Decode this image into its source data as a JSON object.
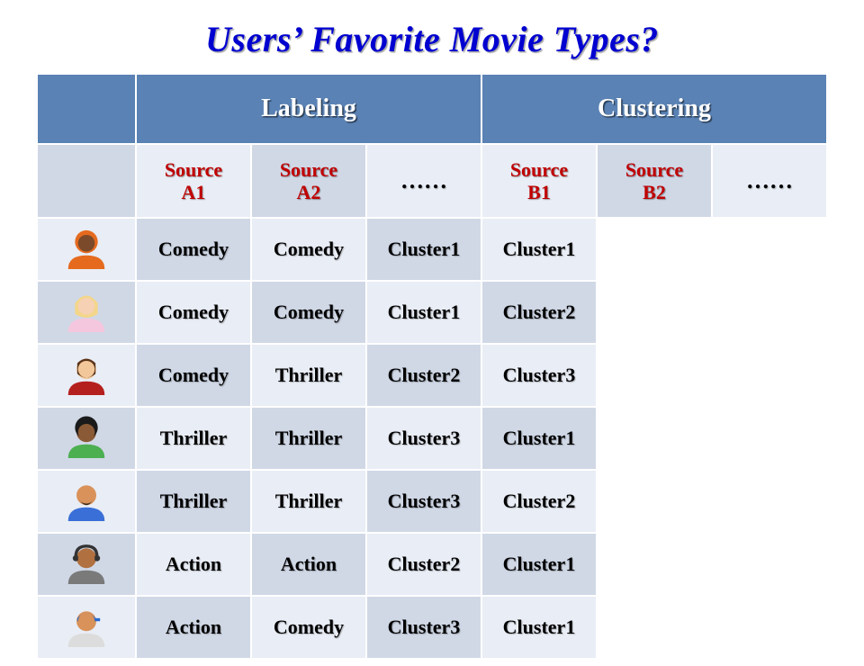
{
  "title": "Users’ Favorite Movie Types?",
  "header_labeling": "Labeling",
  "header_clustering": "Clustering",
  "sources": {
    "a1": "Source A1",
    "a2": "Source A2",
    "b1": "Source B1",
    "b2": "Source B2"
  },
  "ellipsis": "……",
  "rows": [
    {
      "icon": "user-orange-hood",
      "a1": "Comedy",
      "a2": "Comedy",
      "b1": "Cluster1",
      "b2": "Cluster1"
    },
    {
      "icon": "user-pink-blonde",
      "a1": "Comedy",
      "a2": "Comedy",
      "b1": "Cluster1",
      "b2": "Cluster2"
    },
    {
      "icon": "user-red-brown",
      "a1": "Comedy",
      "a2": "Thriller",
      "b1": "Cluster2",
      "b2": "Cluster3"
    },
    {
      "icon": "user-green-afro",
      "a1": "Thriller",
      "a2": "Thriller",
      "b1": "Cluster3",
      "b2": "Cluster1"
    },
    {
      "icon": "user-blue-beard",
      "a1": "Thriller",
      "a2": "Thriller",
      "b1": "Cluster3",
      "b2": "Cluster2"
    },
    {
      "icon": "user-grey-headset",
      "a1": "Action",
      "a2": "Action",
      "b1": "Cluster2",
      "b2": "Cluster1"
    },
    {
      "icon": "user-blue-cap",
      "a1": "Action",
      "a2": "Comedy",
      "b1": "Cluster3",
      "b2": "Cluster1"
    }
  ],
  "chart_data": {
    "type": "table",
    "title": "Users’ Favorite Movie Types?",
    "column_groups": [
      {
        "name": "Labeling",
        "columns": [
          "Source A1",
          "Source A2",
          "……"
        ]
      },
      {
        "name": "Clustering",
        "columns": [
          "Source B1",
          "Source B2",
          "……"
        ]
      }
    ],
    "rows": [
      {
        "user": 1,
        "Source A1": "Comedy",
        "Source A2": "Comedy",
        "Source B1": "Cluster1",
        "Source B2": "Cluster1"
      },
      {
        "user": 2,
        "Source A1": "Comedy",
        "Source A2": "Comedy",
        "Source B1": "Cluster1",
        "Source B2": "Cluster2"
      },
      {
        "user": 3,
        "Source A1": "Comedy",
        "Source A2": "Thriller",
        "Source B1": "Cluster2",
        "Source B2": "Cluster3"
      },
      {
        "user": 4,
        "Source A1": "Thriller",
        "Source A2": "Thriller",
        "Source B1": "Cluster3",
        "Source B2": "Cluster1"
      },
      {
        "user": 5,
        "Source A1": "Thriller",
        "Source A2": "Thriller",
        "Source B1": "Cluster3",
        "Source B2": "Cluster2"
      },
      {
        "user": 6,
        "Source A1": "Action",
        "Source A2": "Action",
        "Source B1": "Cluster2",
        "Source B2": "Cluster1"
      },
      {
        "user": 7,
        "Source A1": "Action",
        "Source A2": "Comedy",
        "Source B1": "Cluster3",
        "Source B2": "Cluster1"
      }
    ]
  }
}
